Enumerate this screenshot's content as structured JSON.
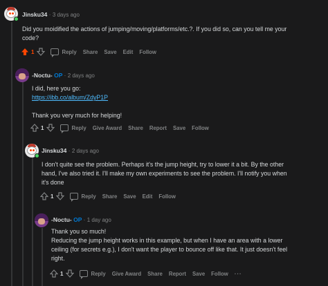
{
  "comments": [
    {
      "author": "Jinsku34",
      "is_op": false,
      "time": "3 days ago",
      "body": [
        "Did you moidified the actions of jumping/moving/platforms/etc.?. If you did so, can you tell me your",
        "code?"
      ],
      "vote_count": "1",
      "upvoted": true,
      "actions": [
        "Reply",
        "Share",
        "Save",
        "Edit",
        "Follow"
      ]
    },
    {
      "author": "-Noctu-",
      "is_op": true,
      "op_label": "OP",
      "time": "2 days ago",
      "body_intro": "I did, here you go:",
      "link": "https://ibb.co/album/ZdyP1P",
      "body_outro": "Thank you very much for helping!",
      "vote_count": "1",
      "upvoted": false,
      "actions": [
        "Reply",
        "Give Award",
        "Share",
        "Report",
        "Save",
        "Follow"
      ]
    },
    {
      "author": "Jinsku34",
      "is_op": false,
      "time": "2 days ago",
      "body": [
        "I don't quite see the problem. Perhaps it's the jump height, try to lower it a bit. By the other",
        "hand, I've also tried it. I'll make my own experiments to see the problem. I'll notify you when",
        "it's done"
      ],
      "vote_count": "1",
      "upvoted": false,
      "actions": [
        "Reply",
        "Share",
        "Save",
        "Edit",
        "Follow"
      ]
    },
    {
      "author": "-Noctu-",
      "is_op": true,
      "op_label": "OP",
      "time": "1 day ago",
      "body": [
        "Thank you so much!",
        "Reducing the jump height works in this example, but when I have an area with a lower",
        "ceiling (for secrets e.g.), I don't want the player to bounce off like that. It just doesn't feel",
        "right."
      ],
      "vote_count": "1",
      "upvoted": false,
      "actions": [
        "Reply",
        "Give Award",
        "Share",
        "Report",
        "Save",
        "Follow"
      ]
    }
  ],
  "separator": "·",
  "more_label": "···",
  "colors": {
    "upvote": "#ff4500",
    "op": "#0079d3",
    "link": "#4fbcff",
    "background": "#1a1a1b",
    "thread_line": "#343536",
    "muted": "#818384"
  },
  "icons": [
    "upvote-arrow-icon",
    "downvote-arrow-icon",
    "comment-bubble-icon",
    "more-options-icon",
    "online-dot-icon"
  ]
}
